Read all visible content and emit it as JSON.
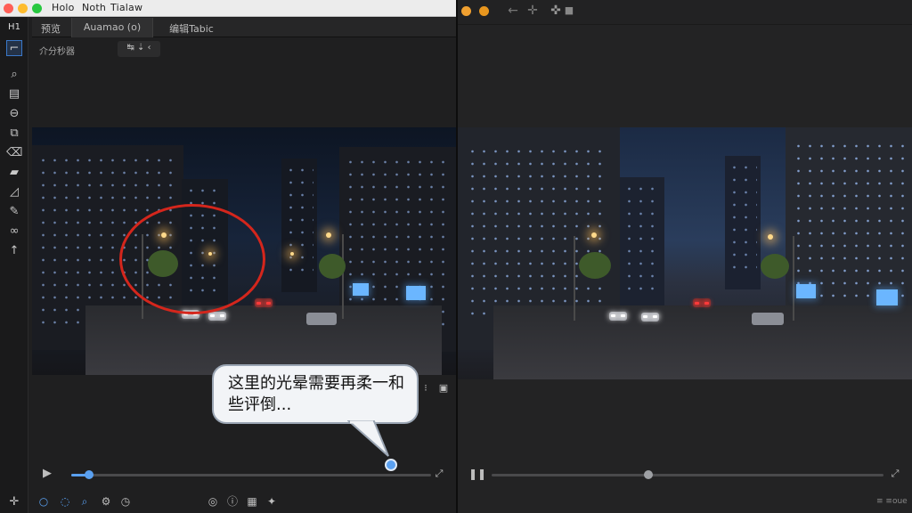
{
  "left_window": {
    "menu": [
      "Holo",
      "Noth",
      "Tialaw"
    ],
    "app_badge": "H1",
    "tabs": [
      "预览",
      "Auamao (o)",
      "编辑Tabic"
    ],
    "subtoolbar": {
      "label": "介分秒器",
      "chip_label": "↹ ⇣ ‹"
    },
    "tools": [
      "select-rect",
      "zoom",
      "layers",
      "minus-circle",
      "copy",
      "eraser",
      "folder",
      "lasso",
      "pen",
      "link",
      "arrow-up"
    ],
    "bottom_icons": [
      "circle",
      "circle",
      "search",
      "gear",
      "clock",
      "target",
      "info",
      "film",
      "sparkle"
    ],
    "timeline_progress": 0.05
  },
  "right_window": {
    "nav_icons": [
      "back-arrow",
      "forward-arrow",
      "crosshair",
      "stop"
    ],
    "timeline_progress": 0.4,
    "corner_label": "≡ ≡oue"
  },
  "annotation": {
    "text": "这里的光晕需要再柔一和些评倒...",
    "circle_color": "#d4261c"
  },
  "colors": {
    "accent": "#4a8fe0",
    "playhead": "#5aa0f0"
  }
}
